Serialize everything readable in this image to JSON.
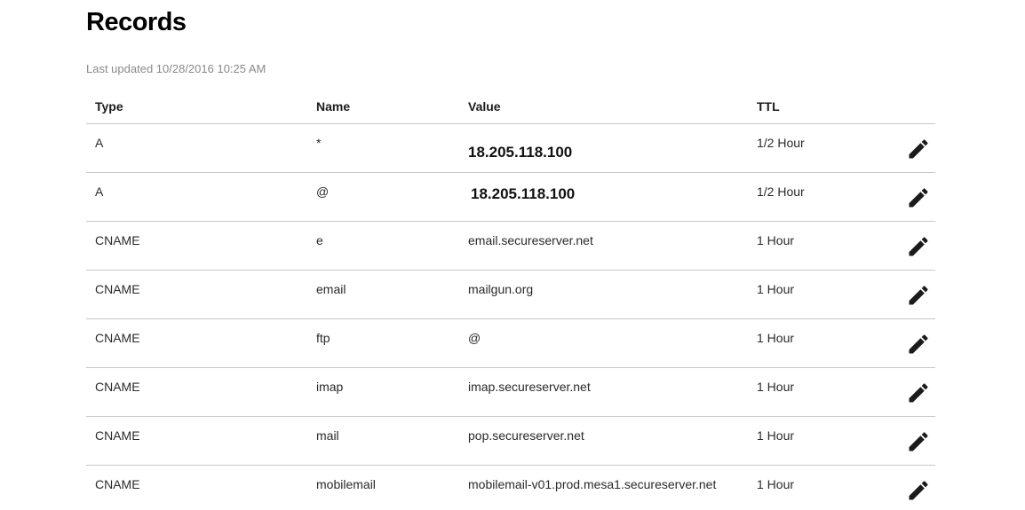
{
  "page": {
    "title": "Records",
    "last_updated": "Last updated 10/28/2016 10:25 AM"
  },
  "table": {
    "columns": {
      "type": "Type",
      "name": "Name",
      "value": "Value",
      "ttl": "TTL"
    },
    "rows": [
      {
        "type": "A",
        "name": "*",
        "value": "18.205.118.100",
        "ttl": "1/2 Hour"
      },
      {
        "type": "A",
        "name": "@",
        "value": "18.205.118.100",
        "ttl": "1/2 Hour"
      },
      {
        "type": "CNAME",
        "name": "e",
        "value": "email.secureserver.net",
        "ttl": "1 Hour"
      },
      {
        "type": "CNAME",
        "name": "email",
        "value": "mailgun.org",
        "ttl": "1 Hour"
      },
      {
        "type": "CNAME",
        "name": "ftp",
        "value": "@",
        "ttl": "1 Hour"
      },
      {
        "type": "CNAME",
        "name": "imap",
        "value": "imap.secureserver.net",
        "ttl": "1 Hour"
      },
      {
        "type": "CNAME",
        "name": "mail",
        "value": "pop.secureserver.net",
        "ttl": "1 Hour"
      },
      {
        "type": "CNAME",
        "name": "mobilemail",
        "value": "mobilemail-v01.prod.mesa1.secureserver.net",
        "ttl": "1 Hour"
      }
    ],
    "row_action_icon": "pencil-icon"
  }
}
